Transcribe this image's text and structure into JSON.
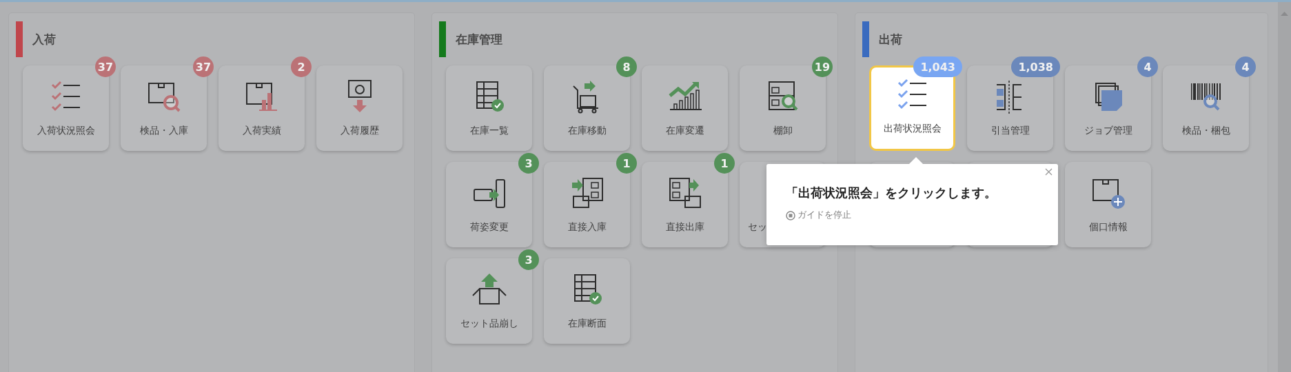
{
  "sections": [
    {
      "title": "入荷",
      "color": "#c0464c",
      "tiles": [
        {
          "kind": "tile",
          "label": "入荷状況照会",
          "badge": "37",
          "highlighted": false
        },
        {
          "kind": "tile",
          "label": "検品・入庫",
          "badge": "37",
          "highlighted": false
        },
        {
          "kind": "tile",
          "label": "入荷実績",
          "badge": "2",
          "highlighted": false
        },
        {
          "kind": "tile",
          "label": "入荷履歴",
          "highlighted": false
        }
      ]
    },
    {
      "title": "在庫管理",
      "color": "#147a1c",
      "tiles": [
        {
          "kind": "tile",
          "label": "在庫一覧",
          "highlighted": false
        },
        {
          "kind": "tile",
          "label": "在庫移動",
          "badge": "8",
          "highlighted": false
        },
        {
          "kind": "tile",
          "label": "在庫変遷",
          "highlighted": false
        },
        {
          "kind": "tile",
          "label": "棚卸",
          "badge": "19",
          "highlighted": false
        },
        {
          "kind": "tile",
          "label": "荷姿変更",
          "badge": "3",
          "highlighted": false
        },
        {
          "kind": "tile",
          "label": "直接入庫",
          "badge": "1",
          "highlighted": false
        },
        {
          "kind": "tile",
          "label": "直接出庫",
          "badge": "1",
          "highlighted": false
        },
        {
          "kind": "covered",
          "label": "セッ",
          "highlighted": false
        },
        {
          "kind": "tile",
          "label": "セット品崩し",
          "badge": "3",
          "highlighted": false
        },
        {
          "kind": "tile",
          "label": "在庫断面",
          "highlighted": false
        }
      ]
    },
    {
      "title": "出荷",
      "color": "#3a6bbf",
      "tiles": [
        {
          "kind": "tile",
          "label": "出荷状況照会",
          "badge": "1,043",
          "highlighted": true
        },
        {
          "kind": "tile",
          "label": "引当管理",
          "badge": "1,038",
          "highlighted": false
        },
        {
          "kind": "tile",
          "label": "ジョブ管理",
          "badge": "4",
          "highlighted": false
        },
        {
          "kind": "tile",
          "label": "検品・梱包",
          "badge": "4",
          "highlighted": false
        },
        {
          "kind": "hidden"
        },
        {
          "kind": "hidden"
        },
        {
          "kind": "tile",
          "label": "個口情報",
          "highlighted": false
        }
      ]
    }
  ],
  "guide": {
    "message": "「出荷状況照会」をクリックします。",
    "stop_label": "ガイドを停止"
  }
}
